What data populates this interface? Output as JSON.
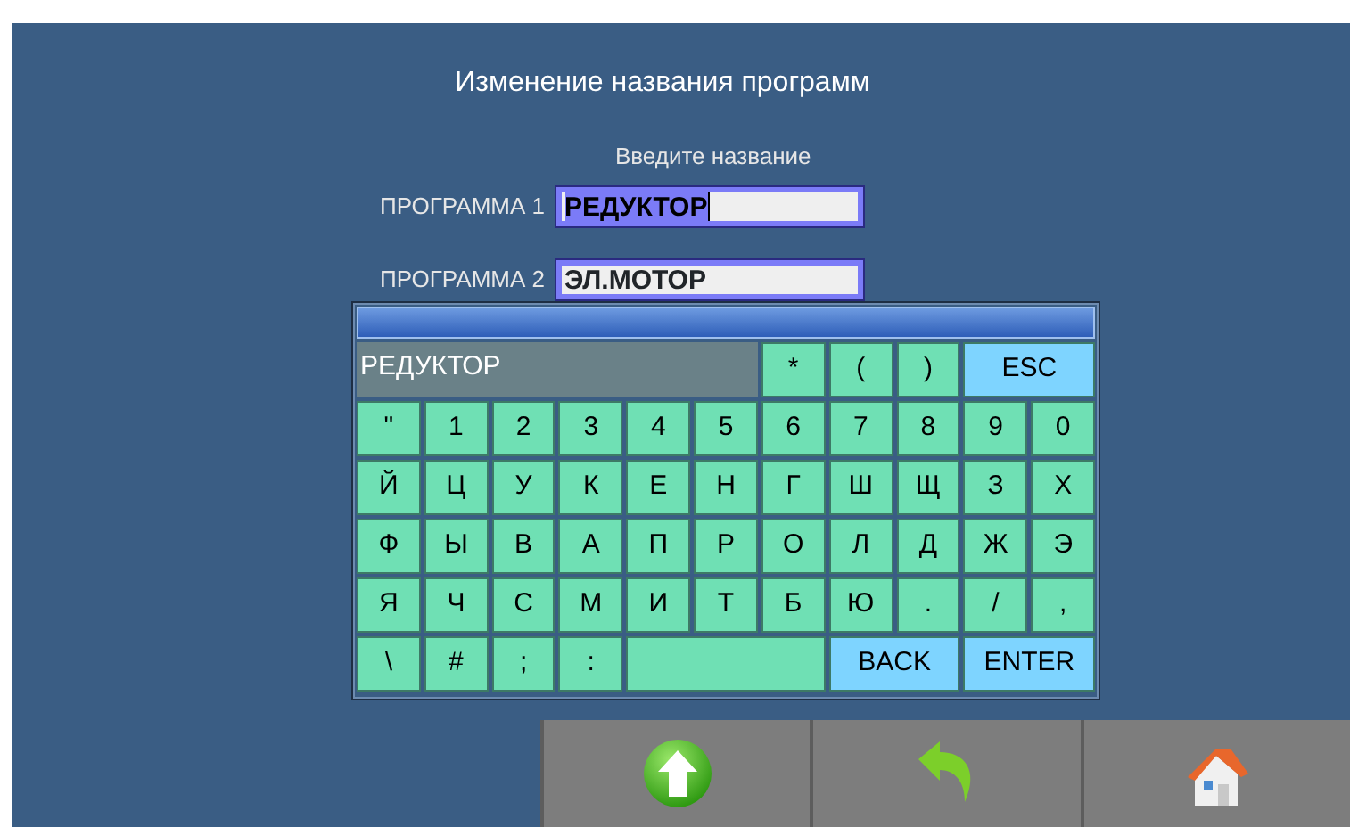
{
  "title": "Изменение названия программ",
  "hint": "Введите название",
  "programs": [
    {
      "label": "ПРОГРАММА 1",
      "value": "РЕДУКТОР",
      "selected": true
    },
    {
      "label": "ПРОГРАММА 2",
      "value": "ЭЛ.МОТОР",
      "selected": false
    }
  ],
  "keyboard": {
    "display": "РЕДУКТОР",
    "top_keys": [
      {
        "kind": "key",
        "label": "*"
      },
      {
        "kind": "key",
        "label": "("
      },
      {
        "kind": "key",
        "label": ")"
      },
      {
        "kind": "action",
        "label": "ESC"
      }
    ],
    "rows": [
      [
        {
          "kind": "key",
          "label": "\""
        },
        {
          "kind": "key",
          "label": "1"
        },
        {
          "kind": "key",
          "label": "2"
        },
        {
          "kind": "key",
          "label": "3"
        },
        {
          "kind": "key",
          "label": "4"
        },
        {
          "kind": "key",
          "label": "5"
        },
        {
          "kind": "key",
          "label": "6"
        },
        {
          "kind": "key",
          "label": "7"
        },
        {
          "kind": "key",
          "label": "8"
        },
        {
          "kind": "key",
          "label": "9"
        },
        {
          "kind": "key",
          "label": "0"
        }
      ],
      [
        {
          "kind": "key",
          "label": "Й"
        },
        {
          "kind": "key",
          "label": "Ц"
        },
        {
          "kind": "key",
          "label": "У"
        },
        {
          "kind": "key",
          "label": "К"
        },
        {
          "kind": "key",
          "label": "Е"
        },
        {
          "kind": "key",
          "label": "Н"
        },
        {
          "kind": "key",
          "label": "Г"
        },
        {
          "kind": "key",
          "label": "Ш"
        },
        {
          "kind": "key",
          "label": "Щ"
        },
        {
          "kind": "key",
          "label": "З"
        },
        {
          "kind": "key",
          "label": "Х"
        }
      ],
      [
        {
          "kind": "key",
          "label": "Ф"
        },
        {
          "kind": "key",
          "label": "Ы"
        },
        {
          "kind": "key",
          "label": "В"
        },
        {
          "kind": "key",
          "label": "А"
        },
        {
          "kind": "key",
          "label": "П"
        },
        {
          "kind": "key",
          "label": "Р"
        },
        {
          "kind": "key",
          "label": "О"
        },
        {
          "kind": "key",
          "label": "Л"
        },
        {
          "kind": "key",
          "label": "Д"
        },
        {
          "kind": "key",
          "label": "Ж"
        },
        {
          "kind": "key",
          "label": "Э"
        }
      ],
      [
        {
          "kind": "key",
          "label": "Я"
        },
        {
          "kind": "key",
          "label": "Ч"
        },
        {
          "kind": "key",
          "label": "С"
        },
        {
          "kind": "key",
          "label": "М"
        },
        {
          "kind": "key",
          "label": "И"
        },
        {
          "kind": "key",
          "label": "Т"
        },
        {
          "kind": "key",
          "label": "Б"
        },
        {
          "kind": "key",
          "label": "Ю"
        },
        {
          "kind": "key",
          "label": "."
        },
        {
          "kind": "key",
          "label": "/"
        },
        {
          "kind": "key",
          "label": ","
        }
      ]
    ],
    "bottom_keys": [
      {
        "kind": "key",
        "label": "\\"
      },
      {
        "kind": "key",
        "label": "#"
      },
      {
        "kind": "key",
        "label": ";"
      },
      {
        "kind": "key",
        "label": ":"
      },
      {
        "kind": "space"
      },
      {
        "kind": "action",
        "label": "BACK"
      },
      {
        "kind": "action",
        "label": "ENTER"
      }
    ]
  },
  "toolbar": [
    {
      "kind": "up"
    },
    {
      "kind": "back"
    },
    {
      "kind": "home"
    }
  ]
}
